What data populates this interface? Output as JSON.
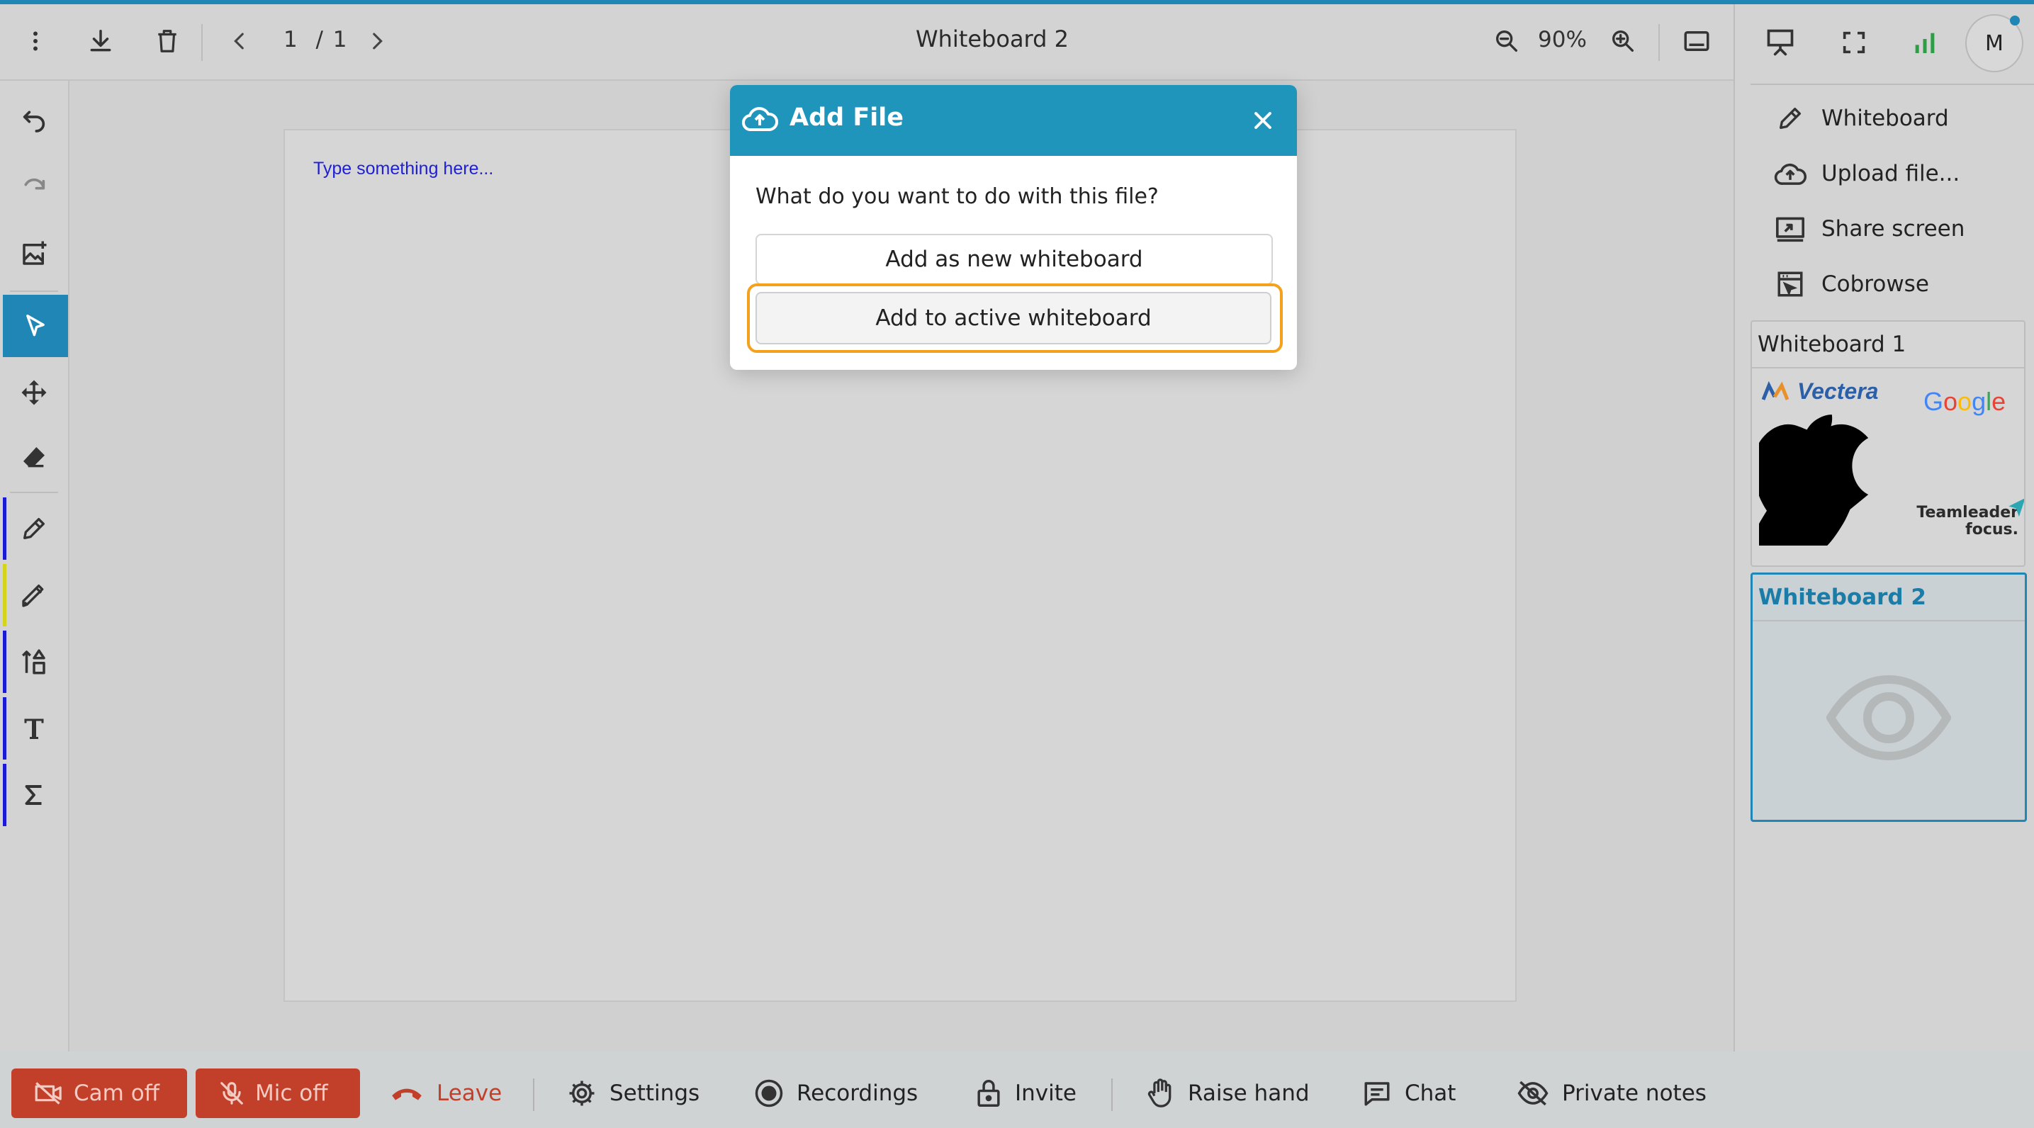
{
  "topbar": {
    "page_current": "1",
    "page_total": "/ 1",
    "title": "Whiteboard 2",
    "zoom": "90%"
  },
  "canvas": {
    "placeholder_text": "Type something here..."
  },
  "right_panel": {
    "avatar_initial": "M",
    "menu": [
      {
        "label": "Whiteboard",
        "icon": "pencil-icon"
      },
      {
        "label": "Upload file...",
        "icon": "cloud-upload-icon"
      },
      {
        "label": "Share screen",
        "icon": "share-screen-icon"
      },
      {
        "label": "Cobrowse",
        "icon": "cobrowse-icon"
      }
    ],
    "whiteboards": [
      {
        "label": "Whiteboard 1",
        "active": false,
        "logos": [
          "Vectera",
          "Google",
          "Apple",
          "Teamleader focus."
        ]
      },
      {
        "label": "Whiteboard 2",
        "active": true
      }
    ]
  },
  "modal": {
    "title": "Add File",
    "question": "What do you want to do with this file?",
    "option_new": "Add as new whiteboard",
    "option_active": "Add to active whiteboard"
  },
  "bottombar": {
    "cam": "Cam off",
    "mic": "Mic off",
    "leave": "Leave",
    "settings": "Settings",
    "recordings": "Recordings",
    "invite": "Invite",
    "raise_hand": "Raise hand",
    "chat": "Chat",
    "private_notes": "Private notes"
  },
  "colors": {
    "accent": "#1f86b5",
    "modal_header": "#1f95bc",
    "danger": "#c2402a",
    "focus_ring": "#f4a11c",
    "pen_blue": "#1a1ad6",
    "highlighter_yellow": "#d4d41a"
  }
}
